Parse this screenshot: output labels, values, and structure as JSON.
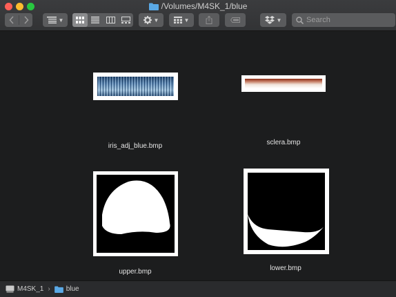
{
  "window": {
    "title": "/Volumes/M4SK_1/blue"
  },
  "toolbar": {
    "back_icon": "chevron-left-icon",
    "forward_icon": "chevron-right-icon",
    "arrange_icon": "arrange-icon",
    "view_icons": [
      "icon-view-icon",
      "list-view-icon",
      "column-view-icon",
      "gallery-view-icon"
    ],
    "action_icon": "gear-icon",
    "group_icon": "group-icon",
    "share_icon": "share-icon",
    "tag_icon": "tag-icon",
    "dropbox_icon": "dropbox-icon",
    "search_placeholder": "Search"
  },
  "files": [
    {
      "name": "iris_adj_blue.bmp",
      "kind": "iris-strip"
    },
    {
      "name": "sclera.bmp",
      "kind": "sclera-strip"
    },
    {
      "name": "upper.bmp",
      "kind": "upper-eyelid-mask"
    },
    {
      "name": "lower.bmp",
      "kind": "lower-eyelid-mask"
    }
  ],
  "pathbar": {
    "items": [
      {
        "label": "M4SK_1",
        "icon": "drive-icon"
      },
      {
        "label": "blue",
        "icon": "folder-icon"
      }
    ]
  },
  "colors": {
    "background": "#1c1d1e",
    "folder": "#5aa9e6"
  }
}
